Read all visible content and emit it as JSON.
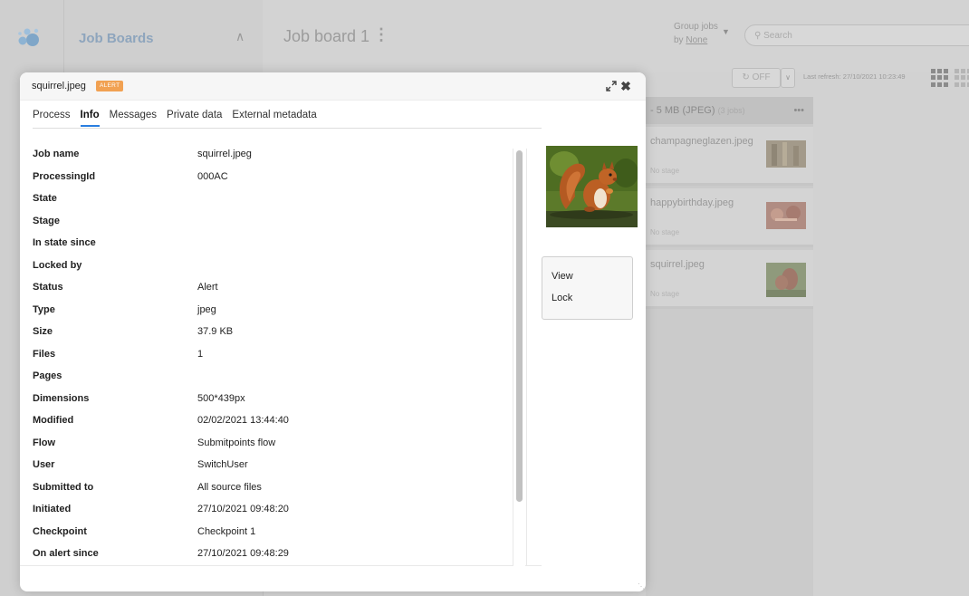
{
  "background": {
    "sidebar_title": "Job Boards",
    "board_title": "Job board 1",
    "group_jobs_label": "Group jobs",
    "group_by_prefix": "by",
    "group_by_value": "None",
    "search_placeholder": "Search",
    "refresh_toggle": "OFF",
    "last_refresh": "Last refresh: 27/10/2021 10:23:49",
    "column_header": "- 5 MB (JPEG)",
    "column_count": "(3 jobs)",
    "column_menu": "•••",
    "cards": [
      {
        "name": "champagneglazen.jpeg",
        "stage": "No stage",
        "thumb": "champagne-thumb"
      },
      {
        "name": "happybirthday.jpeg",
        "stage": "No stage",
        "thumb": "birthday-thumb"
      },
      {
        "name": "squirrel.jpeg",
        "stage": "No stage",
        "thumb": "squirrel-thumb"
      }
    ]
  },
  "modal": {
    "title": "squirrel.jpeg",
    "badge": "ALERT",
    "accent_color": "#2a7ee0",
    "badge_color": "#f1a152",
    "tabs": [
      {
        "label": "Process",
        "active": false
      },
      {
        "label": "Info",
        "active": true
      },
      {
        "label": "Messages",
        "active": false
      },
      {
        "label": "Private data",
        "active": false
      },
      {
        "label": "External metadata",
        "active": false
      }
    ],
    "info": [
      {
        "key": "Job name",
        "value": "squirrel.jpeg"
      },
      {
        "key": "ProcessingId",
        "value": "000AC"
      },
      {
        "key": "State",
        "value": ""
      },
      {
        "key": "Stage",
        "value": ""
      },
      {
        "key": "In state since",
        "value": ""
      },
      {
        "key": "Locked by",
        "value": ""
      },
      {
        "key": "Status",
        "value": "Alert"
      },
      {
        "key": "Type",
        "value": "jpeg"
      },
      {
        "key": "Size",
        "value": "37.9 KB"
      },
      {
        "key": "Files",
        "value": "1"
      },
      {
        "key": "Pages",
        "value": ""
      },
      {
        "key": "Dimensions",
        "value": "500*439px"
      },
      {
        "key": "Modified",
        "value": "02/02/2021 13:44:40"
      },
      {
        "key": "Flow",
        "value": "Submitpoints flow"
      },
      {
        "key": "User",
        "value": "SwitchUser"
      },
      {
        "key": "Submitted to",
        "value": "All source files"
      },
      {
        "key": "Initiated",
        "value": "27/10/2021 09:48:20"
      },
      {
        "key": "Checkpoint",
        "value": "Checkpoint 1"
      },
      {
        "key": "On alert since",
        "value": "27/10/2021 09:48:29"
      }
    ],
    "actions": [
      {
        "label": "View"
      },
      {
        "label": "Lock"
      }
    ]
  }
}
